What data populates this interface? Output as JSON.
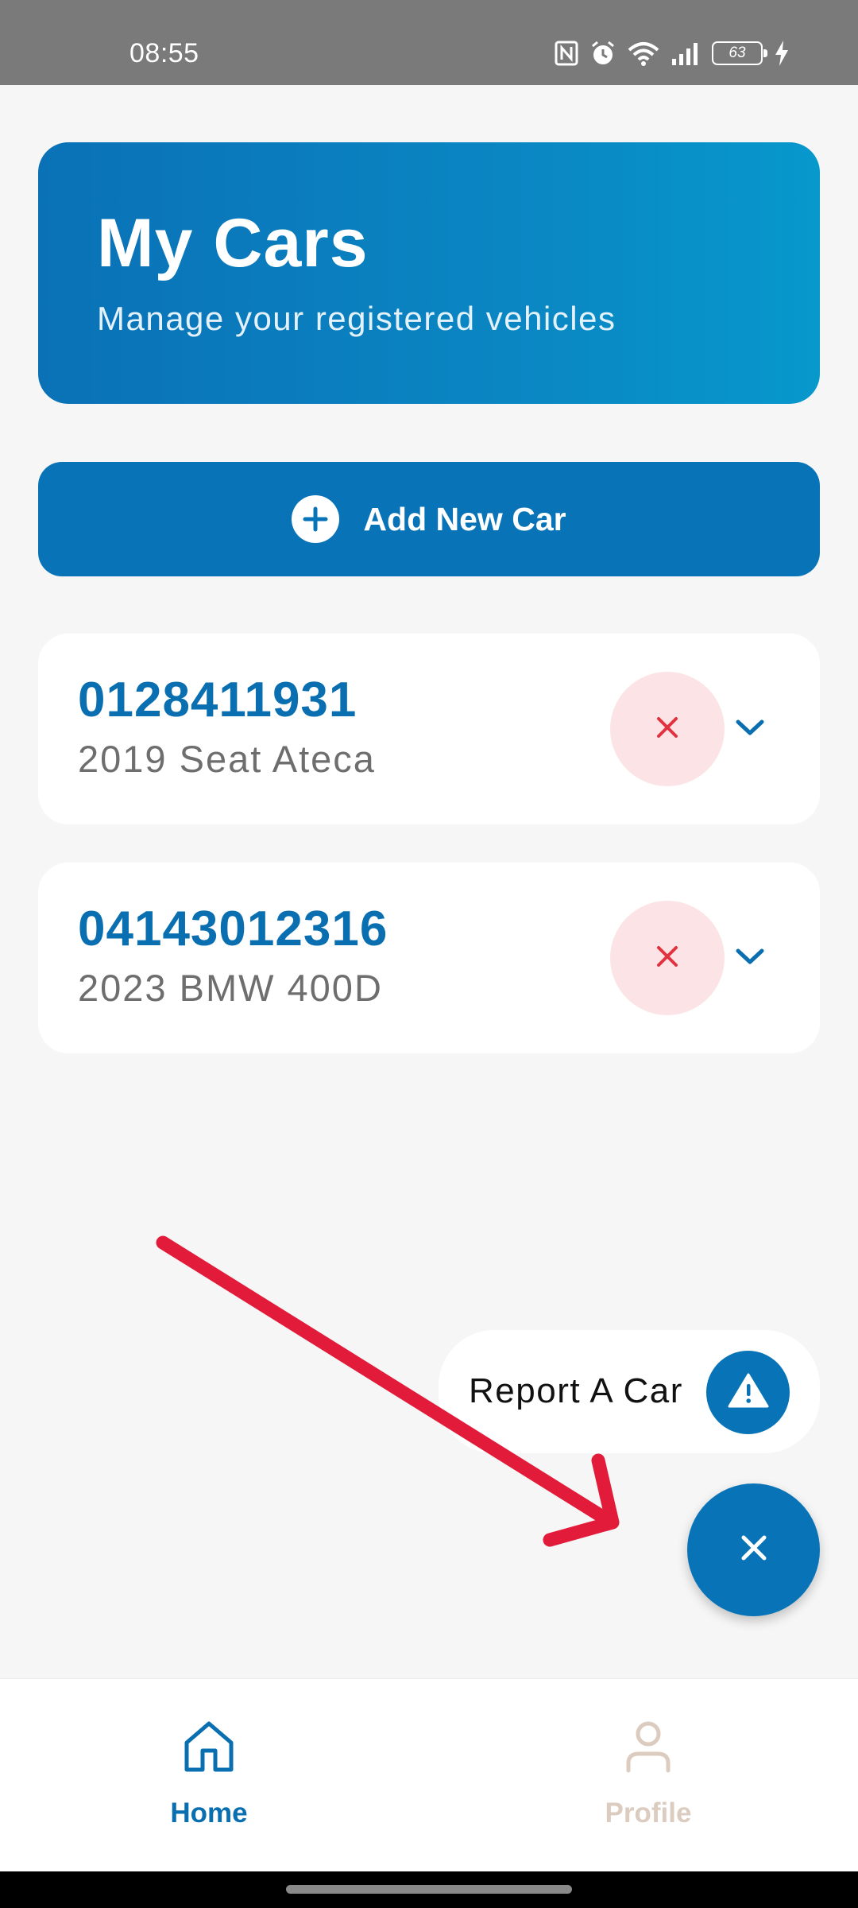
{
  "status_bar": {
    "time": "08:55",
    "battery_level": "63",
    "icons": [
      "nfc-icon",
      "alarm-icon",
      "wifi-icon",
      "signal-icon",
      "battery-icon",
      "charging-icon"
    ]
  },
  "header": {
    "title": "My Cars",
    "subtitle": "Manage your registered vehicles"
  },
  "add_button": {
    "label": "Add New Car",
    "icon": "plus-circle-icon"
  },
  "cars": [
    {
      "plate": "0128411931",
      "model": "2019 Seat Ateca"
    },
    {
      "plate": "04143012316",
      "model": "2023 BMW 400D"
    }
  ],
  "fab_menu": {
    "report_label": "Report A Car",
    "report_icon": "warning-icon",
    "fab_icon": "close-icon"
  },
  "bottom_nav": {
    "items": [
      {
        "label": "Home",
        "icon": "home-icon",
        "active": true
      },
      {
        "label": "Profile",
        "icon": "profile-icon",
        "active": false
      }
    ]
  },
  "colors": {
    "primary": "#0874b7",
    "header_gradient_start": "#0a71b6",
    "header_gradient_end": "#0798cc",
    "delete_bg": "#fce4e6",
    "delete_icon": "#e0323f",
    "annotation_arrow": "#e31b3a",
    "inactive_nav": "#dccbbf"
  }
}
